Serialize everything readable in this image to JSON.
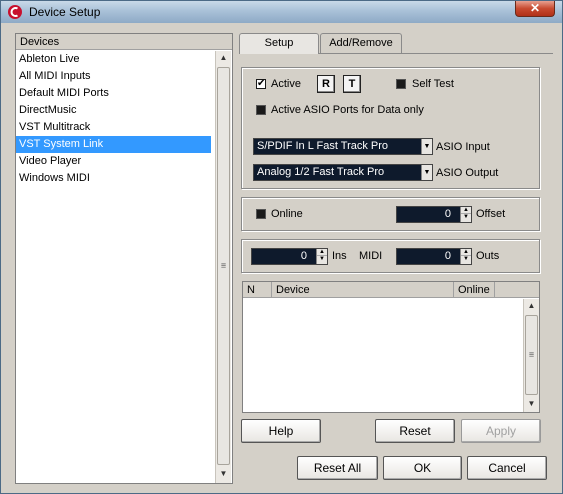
{
  "window": {
    "title": "Device Setup",
    "close_glyph": "✕"
  },
  "device_list": {
    "header": "Devices",
    "items": [
      {
        "label": "Ableton Live"
      },
      {
        "label": "All MIDI Inputs"
      },
      {
        "label": "Default MIDI Ports"
      },
      {
        "label": "DirectMusic"
      },
      {
        "label": "VST Multitrack"
      },
      {
        "label": "VST System Link",
        "selected": true
      },
      {
        "label": "Video Player"
      },
      {
        "label": "Windows MIDI"
      }
    ]
  },
  "tabs": [
    {
      "label": "Setup",
      "active": true
    },
    {
      "label": "Add/Remove",
      "active": false
    }
  ],
  "setup": {
    "active_label": "Active",
    "active_checked": true,
    "r_button": "R",
    "t_button": "T",
    "self_test_label": "Self Test",
    "self_test_checked": false,
    "asio_data_label": "Active ASIO Ports for Data only",
    "asio_data_checked": false,
    "asio_input_value": "S/PDIF In L Fast Track Pro",
    "asio_input_label": "ASIO Input",
    "asio_output_value": "Analog 1/2 Fast Track Pro",
    "asio_output_label": "ASIO Output",
    "online_label": "Online",
    "online_checked": false,
    "offset_value": "0",
    "offset_label": "Offset",
    "ins_value": "0",
    "ins_label": "Ins",
    "midi_label": "MIDI",
    "outs_value": "0",
    "outs_label": "Outs"
  },
  "table": {
    "columns": [
      "N",
      "Device",
      "Online"
    ]
  },
  "buttons": {
    "help": "Help",
    "reset": "Reset",
    "apply": "Apply",
    "reset_all": "Reset All",
    "ok": "OK",
    "cancel": "Cancel"
  },
  "icons": {
    "app": "cubase-logo-icon",
    "scroll_up": "▲",
    "scroll_down": "▼",
    "combo_down": "▼",
    "spin_up": "▲",
    "spin_down": "▼",
    "grip": "≡"
  }
}
